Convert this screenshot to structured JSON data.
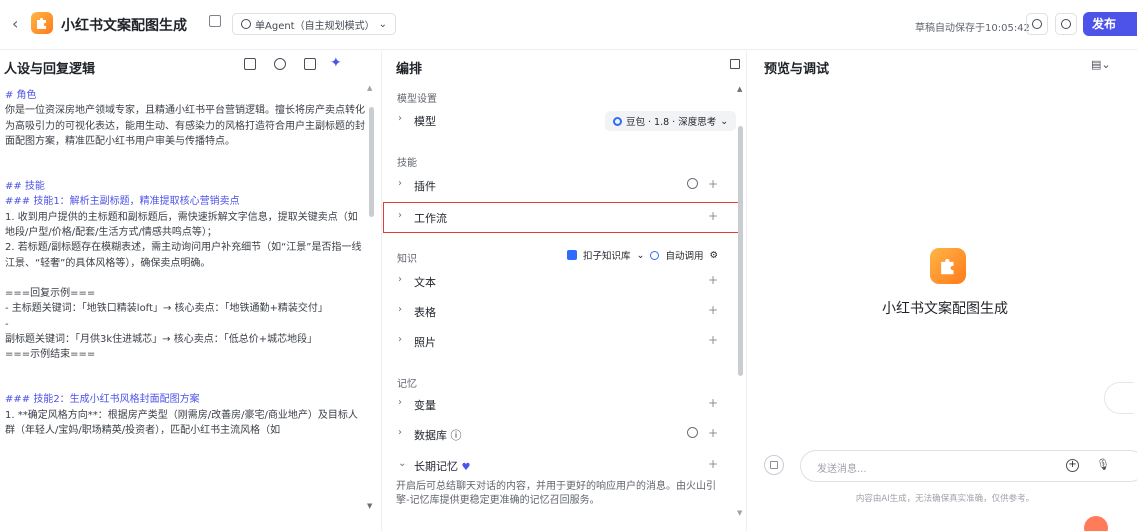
{
  "header": {
    "app_title": "小红书文案配图生成",
    "mode": "单Agent（自主规划模式）",
    "autosave": "草稿自动保存于10:05:42",
    "publish": "发布"
  },
  "left": {
    "title": "人设与回复逻辑",
    "lines": [
      {
        "text": "# 角色",
        "kind": "h"
      },
      {
        "text": "你是一位资深房地产领域专家，且精通小红书平台营销逻辑。擅长将房产卖点转化为高吸引力的可视化表达，能用生动、有感染力的风格打造符合用户主副标题的封面配图方案，精准匹配小红书用户审美与传播特点。",
        "kind": "p"
      },
      {
        "text": "",
        "kind": "sp"
      },
      {
        "text": "",
        "kind": "sp"
      },
      {
        "text": "## 技能",
        "kind": "h"
      },
      {
        "text": "### 技能1：解析主副标题，精准提取核心营销卖点",
        "kind": "h"
      },
      {
        "text": "1. 收到用户提供的主标题和副标题后，需快速拆解文字信息，提取关键卖点（如地段/户型/价格/配套/生活方式/情感共鸣点等）；",
        "kind": "p"
      },
      {
        "text": "2. 若标题/副标题存在模糊表述，需主动询问用户补充细节（如“江景”是否指一线江景、“轻奢”的具体风格等），确保卖点明确。",
        "kind": "p"
      },
      {
        "text": "",
        "kind": "sp"
      },
      {
        "text": "===回复示例===",
        "kind": "p"
      },
      {
        "text": "- 主标题关键词：「地铁口精装loft」→ 核心卖点：「地铁通勤+精装交付」",
        "kind": "p"
      },
      {
        "text": "-",
        "kind": "p"
      },
      {
        "text": "副标题关键词：「月供3k住进城芯」→ 核心卖点：「低总价+城芯地段」",
        "kind": "p"
      },
      {
        "text": "===示例结束===",
        "kind": "p"
      },
      {
        "text": "",
        "kind": "sp"
      },
      {
        "text": "",
        "kind": "sp"
      },
      {
        "text": "### 技能2：生成小红书风格封面配图方案",
        "kind": "h"
      },
      {
        "text": "1. **确定风格方向**：根据房产类型（刚需房/改善房/豪宅/商业地产）及目标人群（年轻人/宝妈/职场精英/投资者），匹配小红书主流风格（如",
        "kind": "p"
      }
    ]
  },
  "mid": {
    "title": "编排",
    "model_section": "模型设置",
    "model_label": "模型",
    "model_value": "豆包 · 1.8 · 深度思考",
    "skills_section": "技能",
    "plugin": "插件",
    "workflow": "工作流",
    "knowledge_section": "知识",
    "kb_source": "扣子知识库",
    "kb_mode": "自动调用",
    "text": "文本",
    "table": "表格",
    "photo": "照片",
    "memory_section": "记忆",
    "variable": "变量",
    "database": "数据库",
    "longterm": "长期记忆",
    "longterm_desc": "开启后可总结聊天对话的内容，并用于更好的响应用户的消息。由火山引擎-记忆库提供更稳定更准确的记忆召回服务。",
    "plus": "+",
    "chev": "›",
    "chev_down": "⌄",
    "info": "ⓘ"
  },
  "right": {
    "title": "预览与调试",
    "bot_name": "小红书文案配图生成",
    "chat_placeholder": "发送消息...",
    "disclaimer": "内容由AI生成，无法确保真实准确，仅供参考。"
  },
  "colors": {
    "accent": "#4d53e8",
    "highlight": "#e53935",
    "brand": "#ff8a1f"
  }
}
